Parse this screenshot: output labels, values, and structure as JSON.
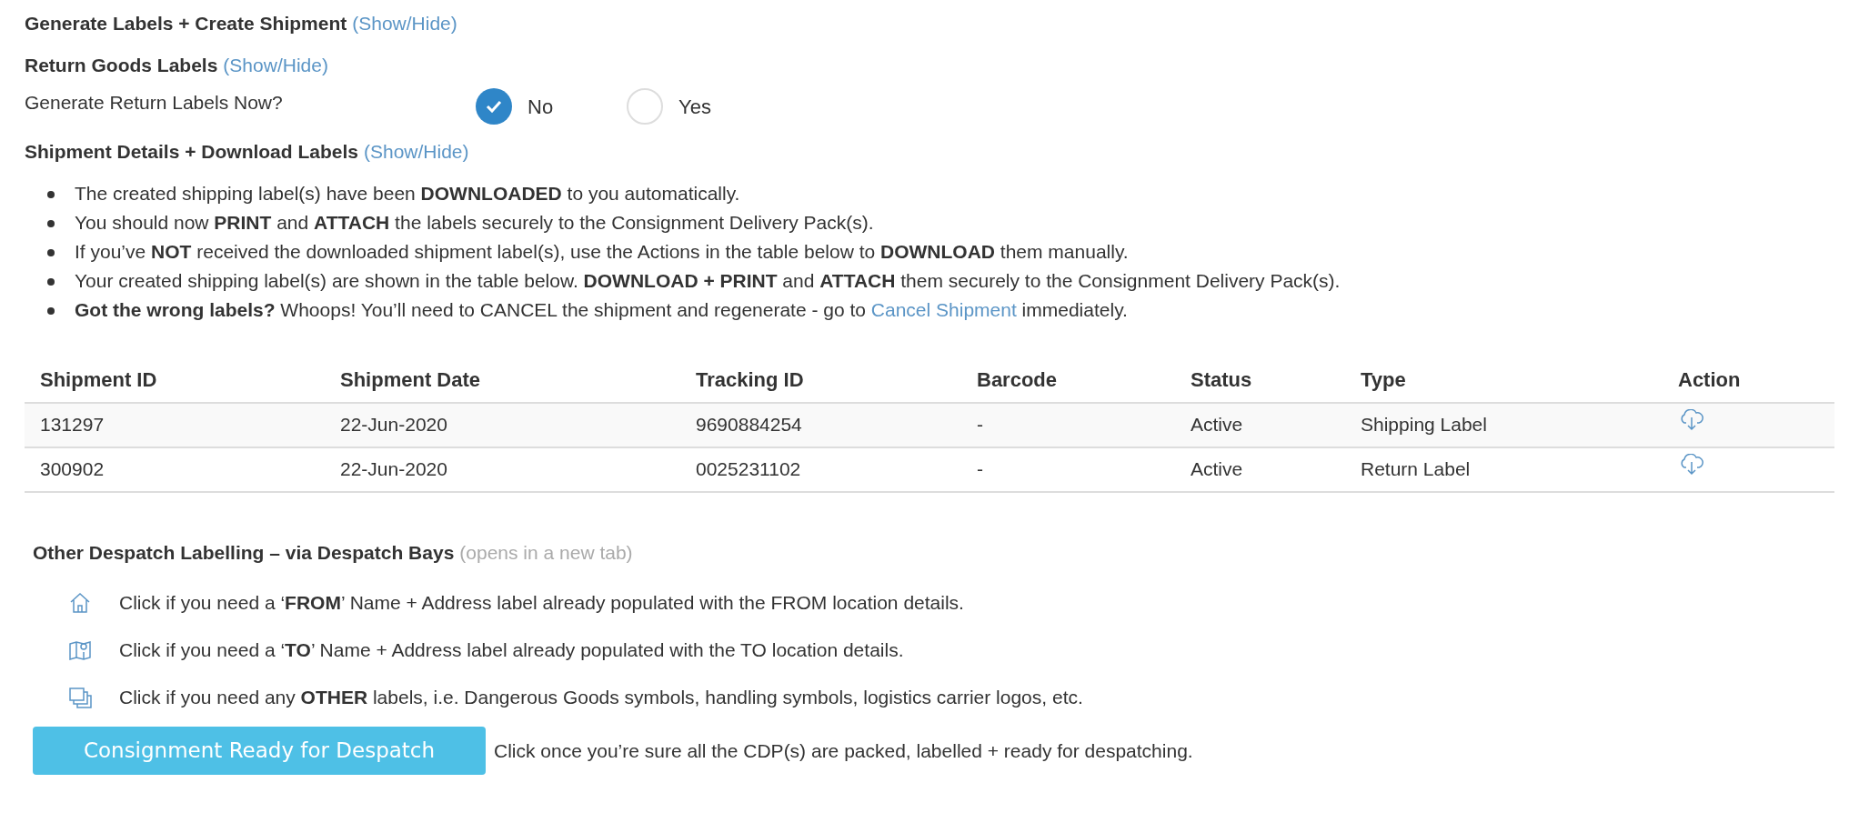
{
  "sections": [
    {
      "title": "Generate Labels + Create Shipment",
      "toggle": "(Show/Hide)"
    },
    {
      "title": "Return Goods Labels",
      "toggle": "(Show/Hide)"
    }
  ],
  "return_labels": {
    "question": "Generate Return Labels Now?",
    "options": [
      {
        "label": "No",
        "selected": true
      },
      {
        "label": "Yes",
        "selected": false
      }
    ]
  },
  "details_section": {
    "title": "Shipment Details + Download Labels",
    "toggle": "(Show/Hide)"
  },
  "instructions": [
    {
      "text": "The created shipping label(s) have been **DOWNLOADED** to you automatically."
    },
    {
      "text": "You should now **PRINT** and **ATTACH** the labels securely to the Consignment Delivery Pack(s)."
    },
    {
      "text": "If you’ve **NOT** received the downloaded shipment label(s), use the Actions in the table below to **DOWNLOAD** them manually."
    },
    {
      "text": "Your created shipping label(s) are shown in the table below. **DOWNLOAD + PRINT** and **ATTACH** them securely to the Consignment Delivery Pack(s)."
    },
    {
      "text": "**Got the wrong labels?** Whoops! You’ll need to CANCEL the shipment and regenerate - go to",
      "link": "Cancel Shipment",
      "after": "immediately."
    }
  ],
  "table": {
    "columns": [
      "Shipment ID",
      "Shipment Date",
      "Tracking ID",
      "Barcode",
      "Status",
      "Type",
      "Action"
    ],
    "rows": [
      {
        "cells": [
          "131297",
          "22-Jun-2020",
          "9690884254",
          "-",
          "Active",
          "Shipping Label"
        ]
      },
      {
        "cells": [
          "300902",
          "22-Jun-2020",
          "0025231102",
          "-",
          "Active",
          "Return Label"
        ]
      }
    ]
  },
  "other": {
    "title": "Other Despatch Labelling – via Despatch Bays",
    "note": "(opens in a new tab)",
    "items": [
      {
        "kind": "from",
        "text": "Click if you need a ‘**FROM**’ Name + Address label already populated with the FROM location details."
      },
      {
        "kind": "to",
        "text": "Click if you need a ‘**TO**’ Name + Address label already populated with the TO location details."
      },
      {
        "kind": "other",
        "text": "Click if you need any **OTHER** labels, i.e. Dangerous Goods symbols, handling symbols, logistics carrier logos, etc."
      }
    ]
  },
  "despatch": {
    "button": "Consignment Ready for Despatch",
    "hint": "Click once you’re sure all the CDP(s) are packed, labelled + ready for despatching."
  }
}
